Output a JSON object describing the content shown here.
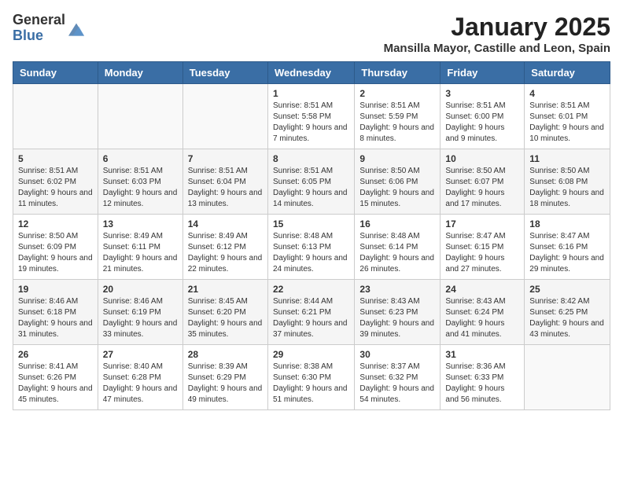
{
  "logo": {
    "general": "General",
    "blue": "Blue"
  },
  "header": {
    "month_year": "January 2025",
    "location": "Mansilla Mayor, Castille and Leon, Spain"
  },
  "weekdays": [
    "Sunday",
    "Monday",
    "Tuesday",
    "Wednesday",
    "Thursday",
    "Friday",
    "Saturday"
  ],
  "weeks": [
    [
      {
        "day": "",
        "info": ""
      },
      {
        "day": "",
        "info": ""
      },
      {
        "day": "",
        "info": ""
      },
      {
        "day": "1",
        "info": "Sunrise: 8:51 AM\nSunset: 5:58 PM\nDaylight: 9 hours and 7 minutes."
      },
      {
        "day": "2",
        "info": "Sunrise: 8:51 AM\nSunset: 5:59 PM\nDaylight: 9 hours and 8 minutes."
      },
      {
        "day": "3",
        "info": "Sunrise: 8:51 AM\nSunset: 6:00 PM\nDaylight: 9 hours and 9 minutes."
      },
      {
        "day": "4",
        "info": "Sunrise: 8:51 AM\nSunset: 6:01 PM\nDaylight: 9 hours and 10 minutes."
      }
    ],
    [
      {
        "day": "5",
        "info": "Sunrise: 8:51 AM\nSunset: 6:02 PM\nDaylight: 9 hours and 11 minutes."
      },
      {
        "day": "6",
        "info": "Sunrise: 8:51 AM\nSunset: 6:03 PM\nDaylight: 9 hours and 12 minutes."
      },
      {
        "day": "7",
        "info": "Sunrise: 8:51 AM\nSunset: 6:04 PM\nDaylight: 9 hours and 13 minutes."
      },
      {
        "day": "8",
        "info": "Sunrise: 8:51 AM\nSunset: 6:05 PM\nDaylight: 9 hours and 14 minutes."
      },
      {
        "day": "9",
        "info": "Sunrise: 8:50 AM\nSunset: 6:06 PM\nDaylight: 9 hours and 15 minutes."
      },
      {
        "day": "10",
        "info": "Sunrise: 8:50 AM\nSunset: 6:07 PM\nDaylight: 9 hours and 17 minutes."
      },
      {
        "day": "11",
        "info": "Sunrise: 8:50 AM\nSunset: 6:08 PM\nDaylight: 9 hours and 18 minutes."
      }
    ],
    [
      {
        "day": "12",
        "info": "Sunrise: 8:50 AM\nSunset: 6:09 PM\nDaylight: 9 hours and 19 minutes."
      },
      {
        "day": "13",
        "info": "Sunrise: 8:49 AM\nSunset: 6:11 PM\nDaylight: 9 hours and 21 minutes."
      },
      {
        "day": "14",
        "info": "Sunrise: 8:49 AM\nSunset: 6:12 PM\nDaylight: 9 hours and 22 minutes."
      },
      {
        "day": "15",
        "info": "Sunrise: 8:48 AM\nSunset: 6:13 PM\nDaylight: 9 hours and 24 minutes."
      },
      {
        "day": "16",
        "info": "Sunrise: 8:48 AM\nSunset: 6:14 PM\nDaylight: 9 hours and 26 minutes."
      },
      {
        "day": "17",
        "info": "Sunrise: 8:47 AM\nSunset: 6:15 PM\nDaylight: 9 hours and 27 minutes."
      },
      {
        "day": "18",
        "info": "Sunrise: 8:47 AM\nSunset: 6:16 PM\nDaylight: 9 hours and 29 minutes."
      }
    ],
    [
      {
        "day": "19",
        "info": "Sunrise: 8:46 AM\nSunset: 6:18 PM\nDaylight: 9 hours and 31 minutes."
      },
      {
        "day": "20",
        "info": "Sunrise: 8:46 AM\nSunset: 6:19 PM\nDaylight: 9 hours and 33 minutes."
      },
      {
        "day": "21",
        "info": "Sunrise: 8:45 AM\nSunset: 6:20 PM\nDaylight: 9 hours and 35 minutes."
      },
      {
        "day": "22",
        "info": "Sunrise: 8:44 AM\nSunset: 6:21 PM\nDaylight: 9 hours and 37 minutes."
      },
      {
        "day": "23",
        "info": "Sunrise: 8:43 AM\nSunset: 6:23 PM\nDaylight: 9 hours and 39 minutes."
      },
      {
        "day": "24",
        "info": "Sunrise: 8:43 AM\nSunset: 6:24 PM\nDaylight: 9 hours and 41 minutes."
      },
      {
        "day": "25",
        "info": "Sunrise: 8:42 AM\nSunset: 6:25 PM\nDaylight: 9 hours and 43 minutes."
      }
    ],
    [
      {
        "day": "26",
        "info": "Sunrise: 8:41 AM\nSunset: 6:26 PM\nDaylight: 9 hours and 45 minutes."
      },
      {
        "day": "27",
        "info": "Sunrise: 8:40 AM\nSunset: 6:28 PM\nDaylight: 9 hours and 47 minutes."
      },
      {
        "day": "28",
        "info": "Sunrise: 8:39 AM\nSunset: 6:29 PM\nDaylight: 9 hours and 49 minutes."
      },
      {
        "day": "29",
        "info": "Sunrise: 8:38 AM\nSunset: 6:30 PM\nDaylight: 9 hours and 51 minutes."
      },
      {
        "day": "30",
        "info": "Sunrise: 8:37 AM\nSunset: 6:32 PM\nDaylight: 9 hours and 54 minutes."
      },
      {
        "day": "31",
        "info": "Sunrise: 8:36 AM\nSunset: 6:33 PM\nDaylight: 9 hours and 56 minutes."
      },
      {
        "day": "",
        "info": ""
      }
    ]
  ]
}
